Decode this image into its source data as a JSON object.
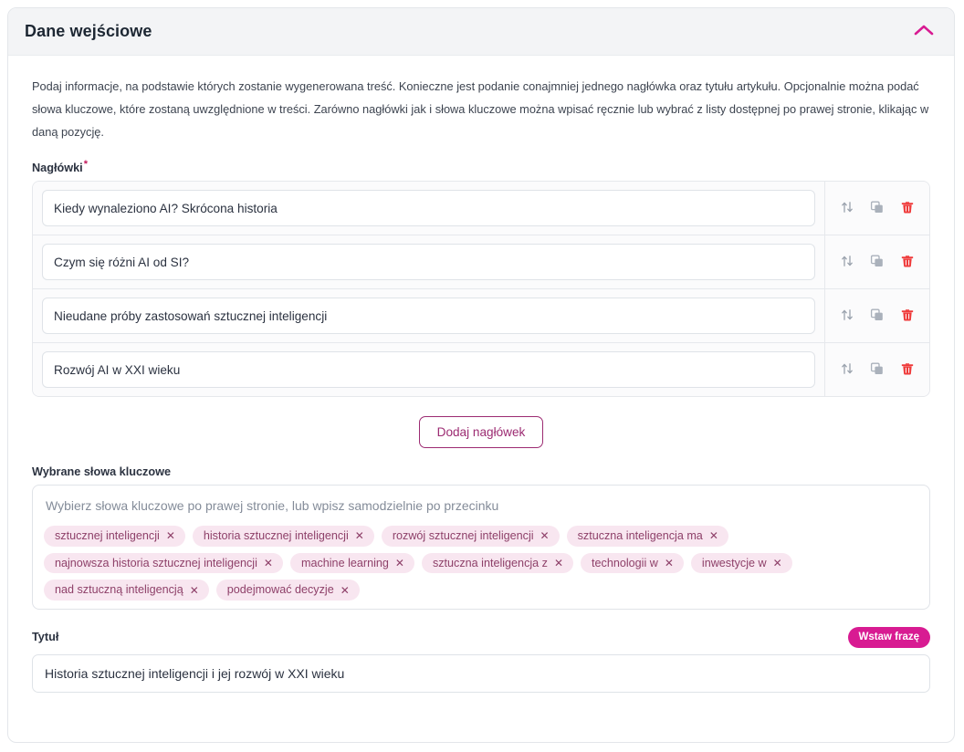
{
  "panel": {
    "title": "Dane wejściowe",
    "collapse_icon": "chevron-up-icon",
    "accent_color": "#d81b92",
    "border_color": "#e3e6ea",
    "header_bg": "#f3f4f6"
  },
  "intro": "Podaj informacje, na podstawie których zostanie wygenerowana treść. Konieczne jest podanie conajmniej jednego nagłówka oraz tytułu artykułu. Opcjonalnie można podać słowa kluczowe, które zostaną uwzględnione w treści. Zarówno nagłówki jak i słowa kluczowe można wpisać ręcznie lub wybrać z listy dostępnej po prawej stronie, klikając w daną pozycję.",
  "headings": {
    "label": "Nagłówki",
    "required_marker": "*",
    "items": [
      {
        "value": "Kiedy wynaleziono AI? Skrócona historia"
      },
      {
        "value": "Czym się różni AI od SI?"
      },
      {
        "value": "Nieudane próby zastosowań sztucznej inteligencji"
      },
      {
        "value": "Rozwój AI w XXI wieku"
      }
    ],
    "row_actions": [
      {
        "name": "reorder-icon",
        "title": "Zmień kolejność"
      },
      {
        "name": "duplicate-icon",
        "title": "Duplikuj"
      },
      {
        "name": "delete-icon",
        "title": "Usuń",
        "color": "#ef3b3b"
      }
    ],
    "add_button": "Dodaj nagłówek"
  },
  "keywords": {
    "label": "Wybrane słowa kluczowe",
    "placeholder": "Wybierz słowa kluczowe po prawej stronie, lub wpisz samodzielnie po przecinku",
    "chip_bg": "#f8e6f0",
    "chip_text": "#8e4069",
    "remove_glyph": "✕",
    "chips": [
      "sztucznej inteligencji",
      "historia sztucznej inteligencji",
      "rozwój sztucznej inteligencji",
      "sztuczna inteligencja ma",
      "najnowsza historia sztucznej inteligencji",
      "machine learning",
      "sztuczna inteligencja z",
      "technologii w",
      "inwestycje w",
      "nad sztuczną inteligencją",
      "podejmować decyzje"
    ]
  },
  "title_field": {
    "label": "Tytuł",
    "insert_phrase_button": "Wstaw frazę",
    "value": "Historia sztucznej inteligencji i jej rozwój w XXI wieku"
  }
}
